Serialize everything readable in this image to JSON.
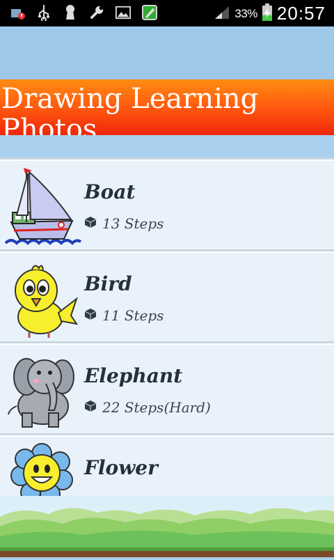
{
  "status_bar": {
    "battery_percent": "33%",
    "time": "20:57",
    "icons": [
      "app-notification-icon",
      "usb-icon",
      "keyhole-icon",
      "wrench-icon",
      "image-icon",
      "pencil-check-icon",
      "signal-icon",
      "battery-charging-icon"
    ]
  },
  "header": {
    "title": "Drawing Learning Photos"
  },
  "items": [
    {
      "name": "Boat",
      "steps": "13 Steps",
      "thumb_icon": "boat-drawing-icon"
    },
    {
      "name": "Bird",
      "steps": "11 Steps",
      "thumb_icon": "bird-drawing-icon"
    },
    {
      "name": "Elephant",
      "steps": "22 Steps(Hard)",
      "thumb_icon": "elephant-drawing-icon"
    },
    {
      "name": "Flower",
      "steps": "",
      "thumb_icon": "flower-drawing-icon"
    }
  ],
  "colors": {
    "title_bg_top": "#ff8c12",
    "title_bg_bottom": "#ef2608",
    "list_bg": "#e9f2fb",
    "sky": "#a9d0ec",
    "grass": "#6cc15a"
  }
}
